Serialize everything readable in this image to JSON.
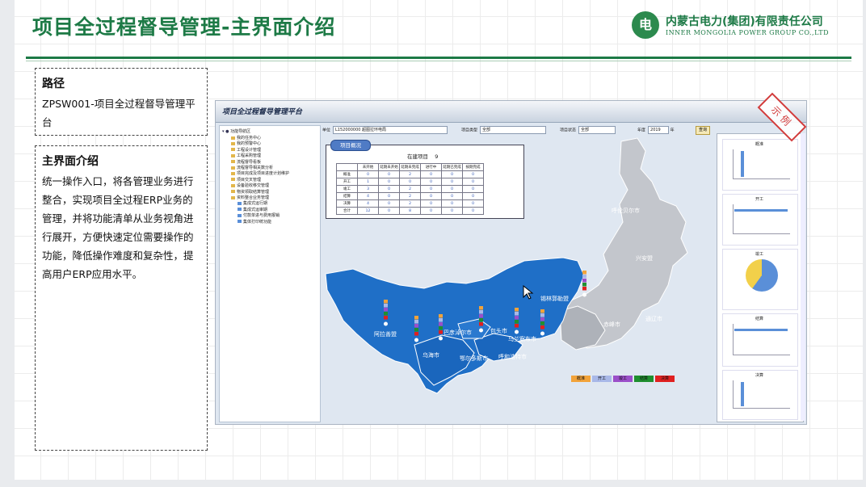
{
  "slide": {
    "title": "项目全过程督导管理-主界面介绍",
    "logo": {
      "cn": "内蒙古电力(集团)有限责任公司",
      "en": "INNER MONGOLIA POWER GROUP CO.,LTD",
      "mark": "电"
    },
    "accent_color": "#1d7a46"
  },
  "path_box": {
    "heading": "路径",
    "text": "ZPSW001-项目全过程督导管理平台"
  },
  "intro_box": {
    "heading": "主界面介绍",
    "text": "统一操作入口，将各管理业务进行整合，实现项目全过程ERP业务的管理，并将功能清单从业务视角进行展开，方便快速定位需要操作的功能，降低操作难度和复杂性，提高用户ERP应用水平。"
  },
  "stamp": "示例",
  "screenshot": {
    "title": "项目全过程督导管理平台",
    "sidebar": {
      "root": "功能导航区",
      "items": [
        "我的任务中心",
        "我的预警中心",
        "工程设计管理",
        "工程采购管理",
        "流程督导看板",
        "流程督导相关数分析",
        "项目完成及项目进度计划维护",
        "项目交叉管理",
        "设备验收移交管理",
        "物资领取结算管理",
        "资料整合业务管理",
        "集成式运行期",
        "集成式运审期",
        "付款单进与费用报销",
        "集体打印统功能"
      ]
    },
    "filters": {
      "unit_label": "单位",
      "unit_value": "L152000000 超图拉环电局",
      "type_label": "项目类型",
      "type_value": "全部",
      "status_label": "项目状态",
      "status_value": "全部",
      "year_label": "年度",
      "year_value": "2019",
      "year_suffix": "年",
      "query": "查询"
    },
    "overview": {
      "tag": "项目概况",
      "heading": "在建项目",
      "count": "9",
      "columns": [
        "",
        "未开始",
        "延期未开始",
        "延期未完成",
        "进行中",
        "延期已完成",
        "按期完成"
      ],
      "rows": [
        {
          "label": "概准",
          "values": [
            "0",
            "0",
            "2",
            "0",
            "0",
            "0"
          ]
        },
        {
          "label": "开工",
          "values": [
            "1",
            "0",
            "0",
            "0",
            "0",
            "0"
          ]
        },
        {
          "label": "竣工",
          "values": [
            "3",
            "0",
            "2",
            "0",
            "0",
            "0"
          ]
        },
        {
          "label": "结算",
          "values": [
            "4",
            "0",
            "2",
            "0",
            "0",
            "0"
          ]
        },
        {
          "label": "决算",
          "values": [
            "4",
            "0",
            "2",
            "0",
            "0",
            "0"
          ]
        },
        {
          "label": "合计",
          "values": [
            "12",
            "0",
            "8",
            "0",
            "0",
            "0"
          ]
        }
      ]
    },
    "map_cities": [
      {
        "name": "呼伦贝尔市",
        "style": "gray"
      },
      {
        "name": "兴安盟",
        "style": "gray"
      },
      {
        "name": "通辽市",
        "style": "gray"
      },
      {
        "name": "赤峰市",
        "style": "gray"
      },
      {
        "name": "锡林郭勒盟",
        "style": "blue"
      },
      {
        "name": "乌兰察布市",
        "style": "blue"
      },
      {
        "name": "包头市",
        "style": "blue"
      },
      {
        "name": "巴彦淖尔市",
        "style": "blue"
      },
      {
        "name": "阿拉善盟",
        "style": "blue"
      },
      {
        "name": "乌海市",
        "style": "blue"
      },
      {
        "name": "鄂尔多斯市",
        "style": "blue"
      },
      {
        "name": "呼和浩特市",
        "style": "blue"
      }
    ],
    "legend": [
      {
        "label": "概准",
        "color": "#f2a33a"
      },
      {
        "label": "开工",
        "color": "#a8b8e8"
      },
      {
        "label": "竣工",
        "color": "#9b4fc9"
      },
      {
        "label": "结算",
        "color": "#1f8f2f"
      },
      {
        "label": "决算",
        "color": "#e02020"
      }
    ],
    "charts": [
      {
        "title": "概准"
      },
      {
        "title": "开工"
      },
      {
        "title": "竣工"
      },
      {
        "title": "结算"
      },
      {
        "title": "决算"
      }
    ]
  }
}
